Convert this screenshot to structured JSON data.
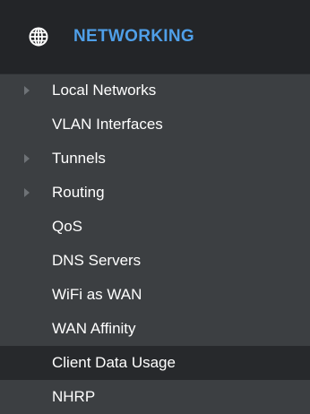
{
  "header": {
    "title": "NETWORKING",
    "icon": "globe-icon",
    "title_color": "#4f9fe8"
  },
  "menu": {
    "items": [
      {
        "label": "Local Networks",
        "has_submenu": true,
        "active": false
      },
      {
        "label": "VLAN Interfaces",
        "has_submenu": false,
        "active": false
      },
      {
        "label": "Tunnels",
        "has_submenu": true,
        "active": false
      },
      {
        "label": "Routing",
        "has_submenu": true,
        "active": false
      },
      {
        "label": "QoS",
        "has_submenu": false,
        "active": false
      },
      {
        "label": "DNS Servers",
        "has_submenu": false,
        "active": false
      },
      {
        "label": "WiFi as WAN",
        "has_submenu": false,
        "active": false
      },
      {
        "label": "WAN Affinity",
        "has_submenu": false,
        "active": false
      },
      {
        "label": "Client Data Usage",
        "has_submenu": false,
        "active": true
      },
      {
        "label": "NHRP",
        "has_submenu": false,
        "active": false
      }
    ]
  },
  "colors": {
    "header_bg": "#232528",
    "panel_bg": "#3c3f42",
    "active_bg": "#27292c",
    "text": "#ffffff",
    "arrow": "#6e7276"
  }
}
